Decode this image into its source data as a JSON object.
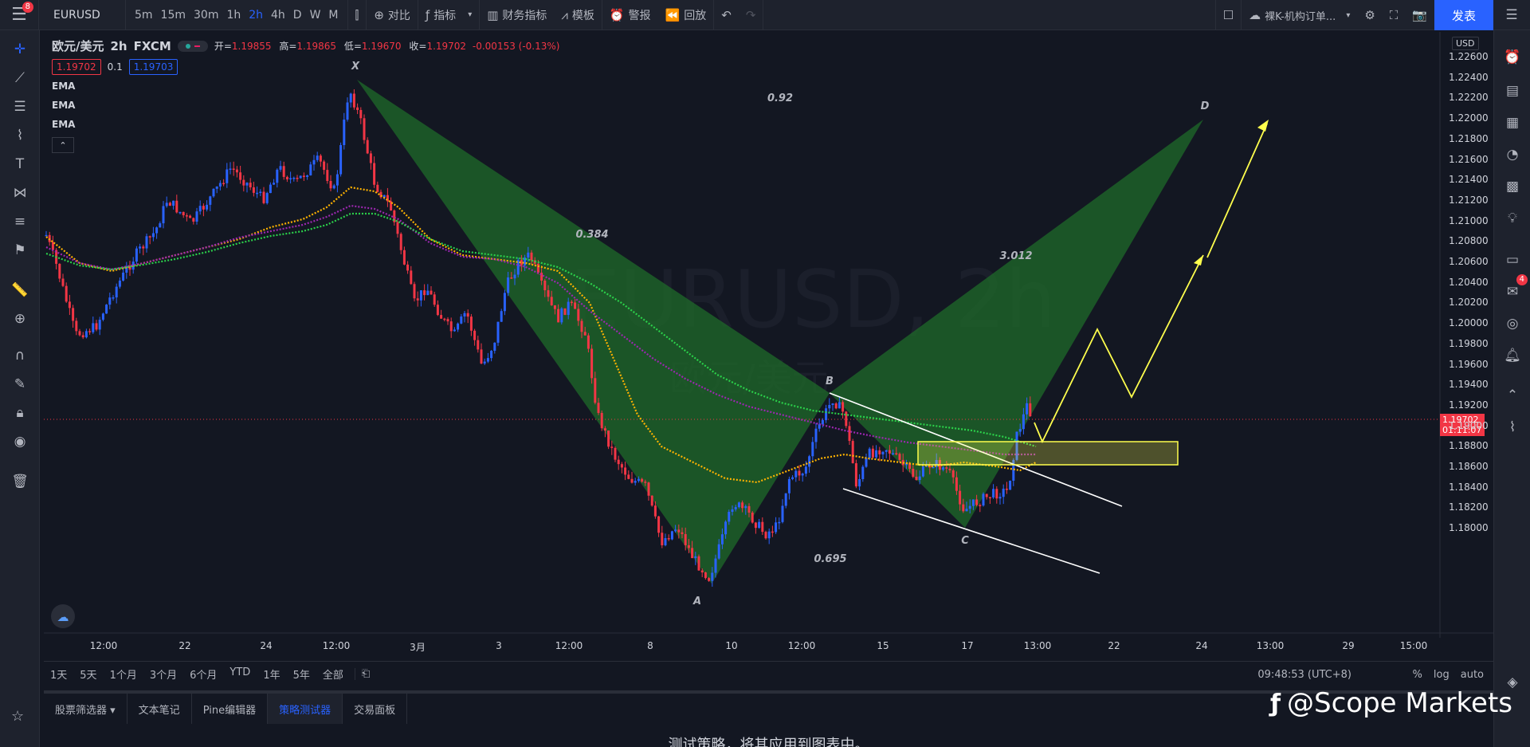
{
  "topbar": {
    "menu_badge": "8",
    "symbol": "EURUSD",
    "timeframes": [
      "5m",
      "15m",
      "30m",
      "1h",
      "2h",
      "4h",
      "D",
      "W",
      "M"
    ],
    "active_timeframe": "2h",
    "compare_label": "对比",
    "indicators_label": "指标",
    "financials_label": "财务指标",
    "templates_label": "模板",
    "alert_label": "警报",
    "replay_label": "回放",
    "layout_name": "裸K-机构订单...",
    "publish_label": "发表"
  },
  "legend": {
    "title": "欧元/美元",
    "interval": "2h",
    "exchange": "FXCM",
    "open_label": "开=",
    "open": "1.19855",
    "high_label": "高=",
    "high": "1.19865",
    "low_label": "低=",
    "low": "1.19670",
    "close_label": "收=",
    "close": "1.19702",
    "change": "-0.00153 (-0.13%)",
    "bid": "1.19702",
    "spread": "0.1",
    "ask": "1.19703",
    "ema": [
      "EMA",
      "EMA",
      "EMA"
    ]
  },
  "chart": {
    "watermark_symbol": "EURUSD, 2h",
    "watermark_name": "欧元/美元",
    "currency": "USD",
    "last_price": "1.19702",
    "countdown": "01:11:07",
    "price_ticks": [
      "1.22600",
      "1.22400",
      "1.22200",
      "1.22000",
      "1.21800",
      "1.21600",
      "1.21400",
      "1.21200",
      "1.21000",
      "1.20800",
      "1.20600",
      "1.20400",
      "1.20200",
      "1.20000",
      "1.19800",
      "1.19600",
      "1.19400",
      "1.19200",
      "1.19000",
      "1.18800",
      "1.18600",
      "1.18400",
      "1.18200",
      "1.18000"
    ],
    "time_ticks": [
      "12:00",
      "22",
      "24",
      "12:00",
      "3月",
      "3",
      "12:00",
      "8",
      "10",
      "12:00",
      "15",
      "17",
      "13:00",
      "22",
      "24",
      "13:00",
      "29",
      "15:00"
    ],
    "pattern_points": {
      "X": "X",
      "A": "A",
      "B": "B",
      "C": "C",
      "D": "D"
    },
    "ratios": {
      "xb": "0.92",
      "ac": "0.384",
      "bd": "3.012",
      "ac_low": "0.695"
    },
    "colors": {
      "up": "#2962ff",
      "down": "#f23645",
      "pattern_fill": "#1f6b2a",
      "ema_fast": "#ffb300",
      "ema_mid": "#9c27b0",
      "ema_slow": "#2bd14a",
      "zone": "#ffff4d",
      "projection": "#ffff4d"
    }
  },
  "rangebar": {
    "ranges": [
      "1天",
      "5天",
      "1个月",
      "3个月",
      "6个月",
      "YTD",
      "1年",
      "5年",
      "全部"
    ],
    "clock": "09:48:53 (UTC+8)",
    "percent": "%",
    "log": "log",
    "auto": "auto"
  },
  "panel": {
    "tabs": [
      "股票筛选器",
      "文本笔记",
      "Pine编辑器",
      "策略测试器",
      "交易面板"
    ],
    "active_tab": "策略测试器",
    "message": "测试策略，将其应用到图表中。"
  },
  "brand": "@Scope Markets",
  "rightrail_badge": "4"
}
